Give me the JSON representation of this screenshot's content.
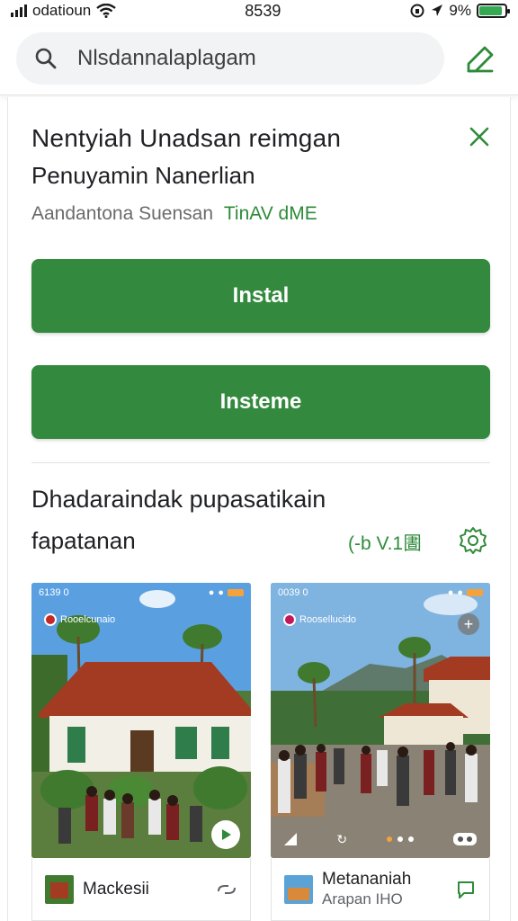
{
  "status_bar": {
    "carrier": "odatioun",
    "time": "8539",
    "battery": "9%",
    "battery_level": 0.9
  },
  "search": {
    "value": "Nlsdannalaplagam"
  },
  "app": {
    "title": "Nentyiah Unadsan reimgan",
    "subtitle": "Penuyamin Nanerlian",
    "developer": "Aandantona Suensan",
    "badge": "TinAV dME"
  },
  "buttons": {
    "install": "Instal",
    "secondary": "Insteme"
  },
  "section": {
    "title": "Dhadaraindak pupasatikain",
    "subtitle": "fapatanan",
    "version": "(-b V.1圕"
  },
  "screenshots": [
    {
      "status_time": "6139 0",
      "label": "Rooelcunaio"
    },
    {
      "status_time": "0039 0",
      "label": "Roosellucido"
    }
  ],
  "rows": [
    {
      "title": "Mackesii",
      "subtitle": ""
    },
    {
      "title": "Metananiah",
      "subtitle": "Arapan IHO"
    }
  ],
  "colors": {
    "accent": "#338a3e",
    "accent_text": "#2e8b3a",
    "battery": "#34a853"
  },
  "icons": [
    "search-icon",
    "edit-icon",
    "close-icon",
    "settings-icon",
    "wifi-icon",
    "battery-icon",
    "play-icon",
    "tag-icon",
    "chat-icon"
  ]
}
